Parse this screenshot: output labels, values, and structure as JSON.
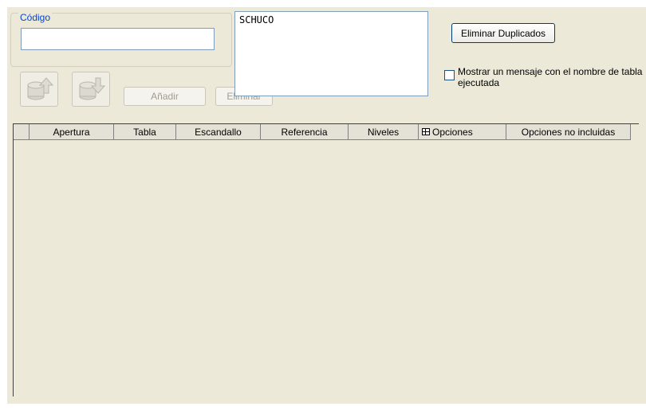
{
  "codigo": {
    "legend": "Código",
    "value": ""
  },
  "toolbar": {
    "up_icon": "move-up-icon",
    "down_icon": "move-down-icon",
    "add_label": "Añadir",
    "remove_label": "Eliminar"
  },
  "list": {
    "items": [
      "SCHUCO"
    ]
  },
  "actions": {
    "remove_duplicates_label": "Eliminar Duplicados"
  },
  "option": {
    "checked": false,
    "label": "Mostrar un mensaje con el nombre de tabla ejecutada"
  },
  "grid": {
    "columns": [
      "",
      "Apertura",
      "Tabla",
      "Escandallo",
      "Referencia",
      "Niveles",
      "Opciones",
      "Opciones no incluidas"
    ],
    "options_icon": "table-icon",
    "rows": []
  },
  "colors": {
    "panel": "#ece9d8",
    "legend": "#0046d5",
    "input_border": "#7f9db9"
  }
}
